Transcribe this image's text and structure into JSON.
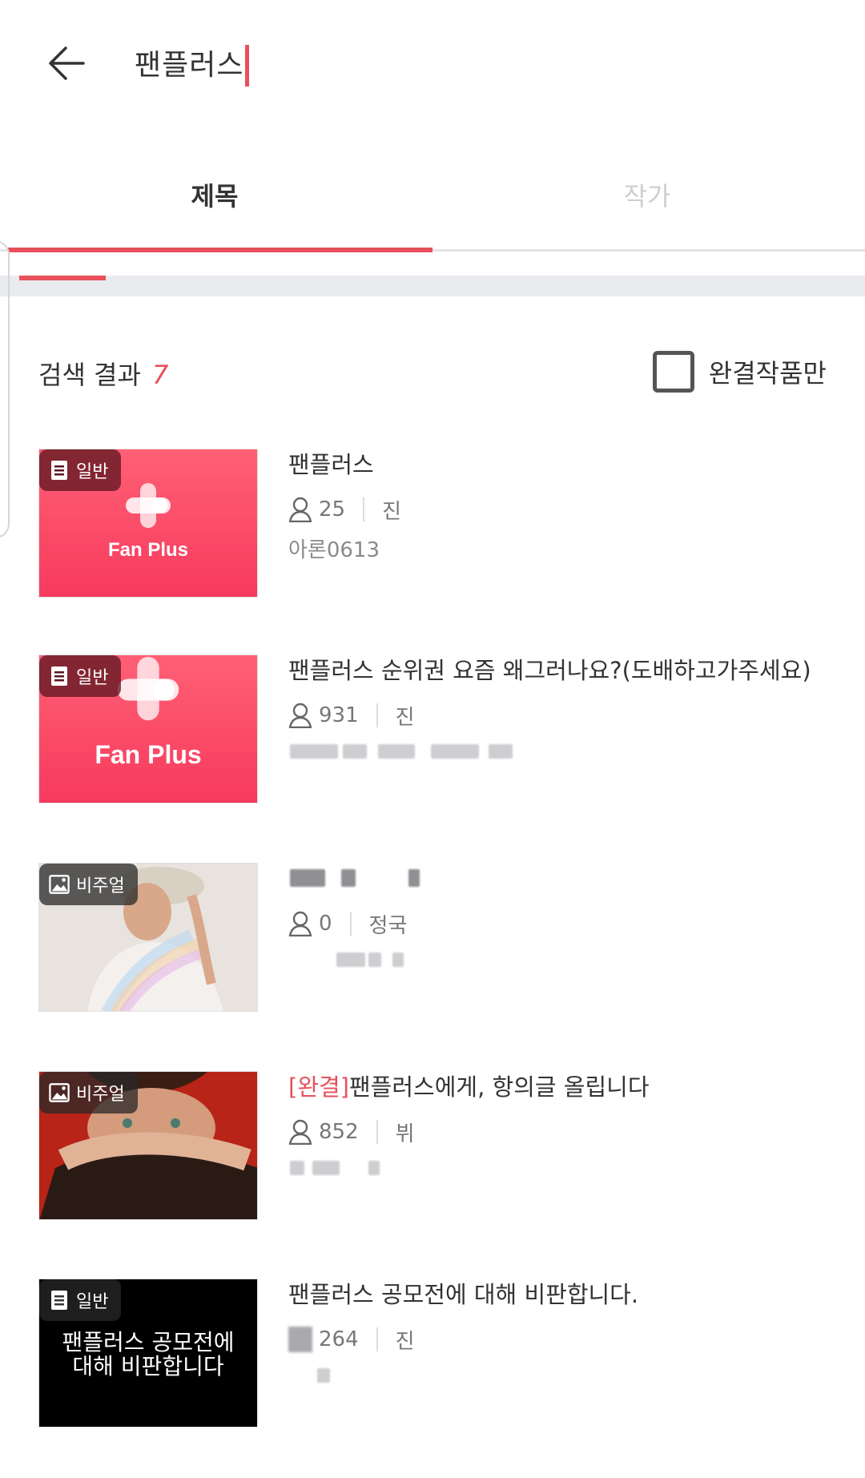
{
  "search": {
    "query": "팬플러스"
  },
  "tabs": [
    {
      "label": "제목",
      "active": true
    },
    {
      "label": "작가",
      "active": false
    }
  ],
  "results": {
    "label": "검색 결과",
    "count": "7"
  },
  "filter": {
    "label": "완결작품만",
    "checked": false
  },
  "colors": {
    "accent": "#e8505b",
    "pink": "#f73a5e",
    "text": "#333333"
  },
  "items": [
    {
      "badge": "일반",
      "badge_icon": "document-icon",
      "thumb_text": "Fan Plus",
      "title": "팬플러스",
      "views": "25",
      "category": "진",
      "author": "아론0613"
    },
    {
      "badge": "일반",
      "badge_icon": "document-icon",
      "thumb_text": "Fan Plus",
      "title": "팬플러스 순위권 요즘 왜그러나요?(도배하고가주세요)",
      "views": "931",
      "category": "진",
      "author": ""
    },
    {
      "badge": "비주얼",
      "badge_icon": "image-icon",
      "title": "",
      "views": "0",
      "category": "정국",
      "author": ""
    },
    {
      "badge": "비주얼",
      "badge_icon": "image-icon",
      "completed_tag": "[완결]",
      "title": "팬플러스에게, 항의글 올립니다",
      "views": "852",
      "category": "뷔",
      "author": ""
    },
    {
      "badge": "일반",
      "badge_icon": "document-icon",
      "thumb_text_line1": "팬플러스 공모전에",
      "thumb_text_line2": "대해 비판합니다",
      "title": "팬플러스 공모전에 대해 비판합니다.",
      "views": "264",
      "category": "진",
      "author": ""
    }
  ]
}
